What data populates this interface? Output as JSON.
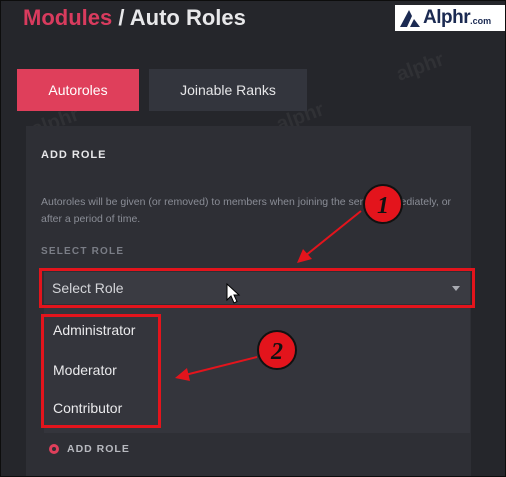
{
  "header": {
    "breadcrumb_module": "Modules",
    "breadcrumb_separator": " / ",
    "page_title": "Auto Roles"
  },
  "brand": {
    "name": "Alphr",
    "tld": ".com"
  },
  "tabs": [
    {
      "label": "Autoroles",
      "active": true
    },
    {
      "label": "Joinable Ranks",
      "active": false
    }
  ],
  "section": {
    "title": "ADD ROLE",
    "description": "Autoroles will be given (or removed) to members when joining the server immediately, or after a period of time.",
    "select_label": "SELECT ROLE",
    "select_value": "Select Role",
    "options": [
      "Administrator",
      "Moderator",
      "Contributor"
    ],
    "add_button": "ADD ROLE"
  },
  "annotations": {
    "step1": "1",
    "step2": "2"
  },
  "watermark": "alphr",
  "colors": {
    "accent": "#df3f5b",
    "background": "#25262b",
    "panel": "#2e2f35",
    "highlight": "#e3141c"
  }
}
